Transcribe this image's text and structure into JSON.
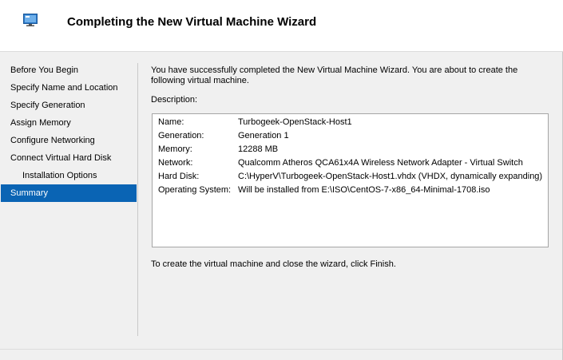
{
  "header": {
    "title": "Completing the New Virtual Machine Wizard",
    "icon": "monitor-icon"
  },
  "nav": {
    "items": [
      {
        "label": "Before You Begin"
      },
      {
        "label": "Specify Name and Location"
      },
      {
        "label": "Specify Generation"
      },
      {
        "label": "Assign Memory"
      },
      {
        "label": "Configure Networking"
      },
      {
        "label": "Connect Virtual Hard Disk"
      },
      {
        "label": "Installation Options"
      },
      {
        "label": "Summary"
      }
    ],
    "active_index": 7,
    "active_color": "#0a64b4"
  },
  "main": {
    "intro": "You have successfully completed the New Virtual Machine Wizard. You are about to create the following virtual machine.",
    "description_label": "Description:",
    "details": [
      {
        "key": "Name:",
        "value": "Turbogeek-OpenStack-Host1"
      },
      {
        "key": "Generation:",
        "value": "Generation 1"
      },
      {
        "key": "Memory:",
        "value": "12288 MB"
      },
      {
        "key": "Network:",
        "value": "Qualcomm Atheros QCA61x4A Wireless Network Adapter - Virtual Switch"
      },
      {
        "key": "Hard Disk:",
        "value": "C:\\HyperV\\Turbogeek-OpenStack-Host1.vhdx (VHDX, dynamically expanding)"
      },
      {
        "key": "Operating System:",
        "value": "Will be installed from E:\\ISO\\CentOS-7-x86_64-Minimal-1708.iso"
      }
    ],
    "finish_text": "To create the virtual machine and close the wizard, click Finish."
  }
}
